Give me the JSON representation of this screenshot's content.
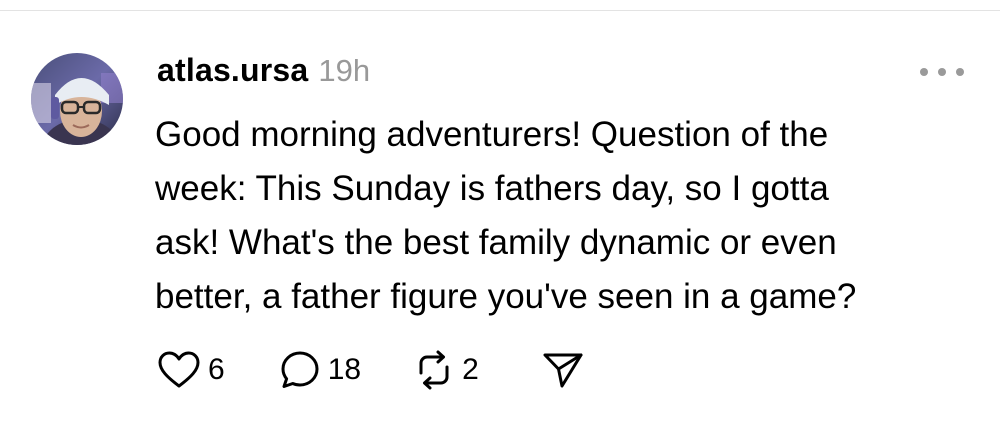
{
  "post": {
    "username": "atlas.ursa",
    "timestamp": "19h",
    "text_lines": [
      "Good morning adventurers! Question of the",
      "week: This Sunday is fathers day, so I gotta",
      "ask! What's the best family dynamic or even",
      "better, a father figure you've seen in a game?"
    ]
  },
  "actions": {
    "likes": "6",
    "replies": "18",
    "reposts": "2"
  },
  "icons": {
    "more": "more-horizontal-icon",
    "like": "heart-icon",
    "reply": "speech-bubble-icon",
    "repost": "repost-icon",
    "share": "send-icon"
  },
  "colors": {
    "text": "#000000",
    "muted": "#999999",
    "divider": "#e3e3e3"
  }
}
